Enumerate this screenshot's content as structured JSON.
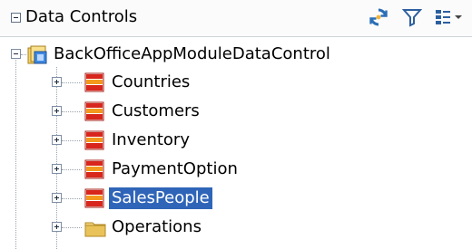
{
  "panel": {
    "title": "Data Controls",
    "toolbar": {
      "refresh_icon": "refresh-icon",
      "filter_icon": "filter-icon",
      "options_icon": "tree-options-icon",
      "dropdown_icon": "chevron-down-icon"
    }
  },
  "tree": {
    "root": {
      "label": "BackOfficeAppModuleDataControl",
      "icon": "data-control-icon",
      "expanded": true
    },
    "children": [
      {
        "label": "Countries",
        "icon": "collection-icon",
        "selected": false
      },
      {
        "label": "Customers",
        "icon": "collection-icon",
        "selected": false
      },
      {
        "label": "Inventory",
        "icon": "collection-icon",
        "selected": false
      },
      {
        "label": "PaymentOption",
        "icon": "collection-icon",
        "selected": false
      },
      {
        "label": "SalesPeople",
        "icon": "collection-icon",
        "selected": true
      },
      {
        "label": "Operations",
        "icon": "folder-icon",
        "selected": false
      }
    ]
  },
  "colors": {
    "selection": "#2f65b8",
    "collection_red": "#d8261c",
    "collection_orange": "#f39a1e",
    "folder": "#e9c25a"
  }
}
